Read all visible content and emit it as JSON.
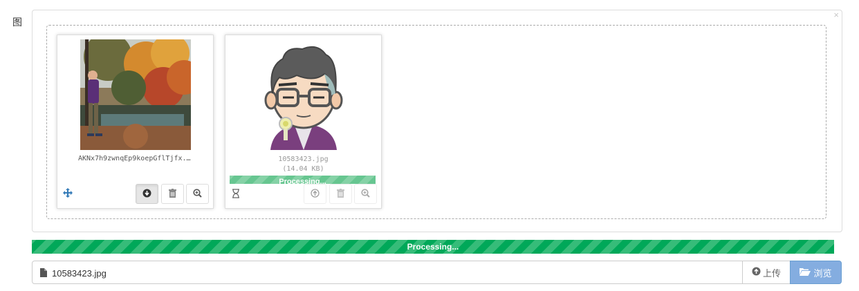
{
  "form": {
    "field_label": "图"
  },
  "preview": {
    "close_glyph": "×",
    "thumbs": [
      {
        "file_name": "AKNx7h9zwnqEp9koepGflTjfx...",
        "state": "uploaded",
        "actions": [
          "download-icon",
          "trash-icon",
          "zoom-in-icon"
        ],
        "indicator_icon": "move-icon"
      },
      {
        "file_name": "10583423.jpg",
        "file_size": "(14.04 KB)",
        "progress_text": "Processing...",
        "state": "processing",
        "actions": [
          "upload-icon",
          "trash-icon",
          "zoom-in-icon"
        ],
        "indicator_icon": "hourglass-icon"
      }
    ]
  },
  "progress": {
    "text": "Processing...",
    "percent": 100
  },
  "file_input": {
    "caption": "10583423.jpg",
    "upload_label": "上传",
    "browse_label": "浏览"
  },
  "colors": {
    "progress_green": "#00a859",
    "browse_blue": "#84ade0",
    "drag_icon_blue": "#337ab7"
  }
}
